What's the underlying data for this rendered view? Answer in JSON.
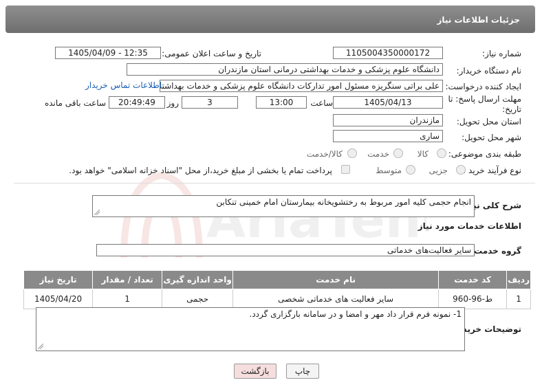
{
  "header": {
    "title": "جزئیات اطلاعات نیاز"
  },
  "fields": {
    "need_number_label": "شماره نیاز:",
    "need_number": "1105004350000172",
    "announce_label": "تاریخ و ساعت اعلان عمومی:",
    "announce_value": "1405/04/09 - 12:35",
    "buyer_org_label": "نام دستگاه خریدار:",
    "buyer_org": "دانشگاه علوم پزشکی و خدمات بهداشتی  درمانی استان مازندران",
    "requester_label": "ایجاد کننده درخواست:",
    "requester": "علی براتی سنگریزه مسئول امور تدارکات دانشگاه علوم پزشکی و خدمات بهداشتی درمانی استان مازندران",
    "contact_link": "اطلاعات تماس خریدار",
    "deadline_label": "مهلت ارسال پاسخ: تا تاریخ:",
    "deadline_date": "1405/04/13",
    "time_label": "ساعت",
    "deadline_time": "13:00",
    "days_value": "3",
    "days_label": "روز و",
    "remaining_time": "20:49:49",
    "remaining_label": "ساعت باقی مانده",
    "province_label": "استان محل تحویل:",
    "province": "مازندران",
    "city_label": "شهر محل تحویل:",
    "city": "ساری",
    "category_label": "طبقه بندی موضوعی:",
    "category_options": [
      "کالا",
      "خدمت",
      "کالا/خدمت"
    ],
    "purchase_type_label": "نوع فرآیند خرید :",
    "purchase_type_options": [
      "جزیی",
      "متوسط"
    ],
    "payment_note": "پرداخت تمام یا بخشی از مبلغ خرید،از محل \"اسناد خزانه اسلامی\" خواهد بود."
  },
  "description": {
    "label": "شرح کلی نیاز:",
    "value": "انجام حجمی کلیه امور مربوط به رختشویخانه بیمارستان امام خمینی تنکابن"
  },
  "services": {
    "section_title": "اطلاعات خدمات مورد نیاز",
    "group_label": "گروه خدمت:",
    "group_value": "سایر فعالیت‌های خدماتی",
    "columns": [
      "ردیف",
      "کد خدمت",
      "نام خدمت",
      "واحد اندازه گیری",
      "تعداد / مقدار",
      "تاریخ نیاز"
    ],
    "rows": [
      {
        "index": "1",
        "code": "ط-96-960",
        "name": "سایر فعالیت های خدماتی شخصی",
        "unit": "حجمی",
        "qty": "1",
        "date": "1405/04/20"
      }
    ]
  },
  "buyer_notes": {
    "label": "توضیحات خریدار:",
    "value": "1- نمونه فرم قرار داد مهر و امضا و در سامانه بارگزاری گردد."
  },
  "buttons": {
    "print": "چاپ",
    "back": "بازگشت"
  },
  "watermark": {
    "text": "AriaTender.net"
  },
  "colors": {
    "header": "#7a7a7a",
    "link": "#1a5fb4",
    "back_button": "#f6dede"
  }
}
